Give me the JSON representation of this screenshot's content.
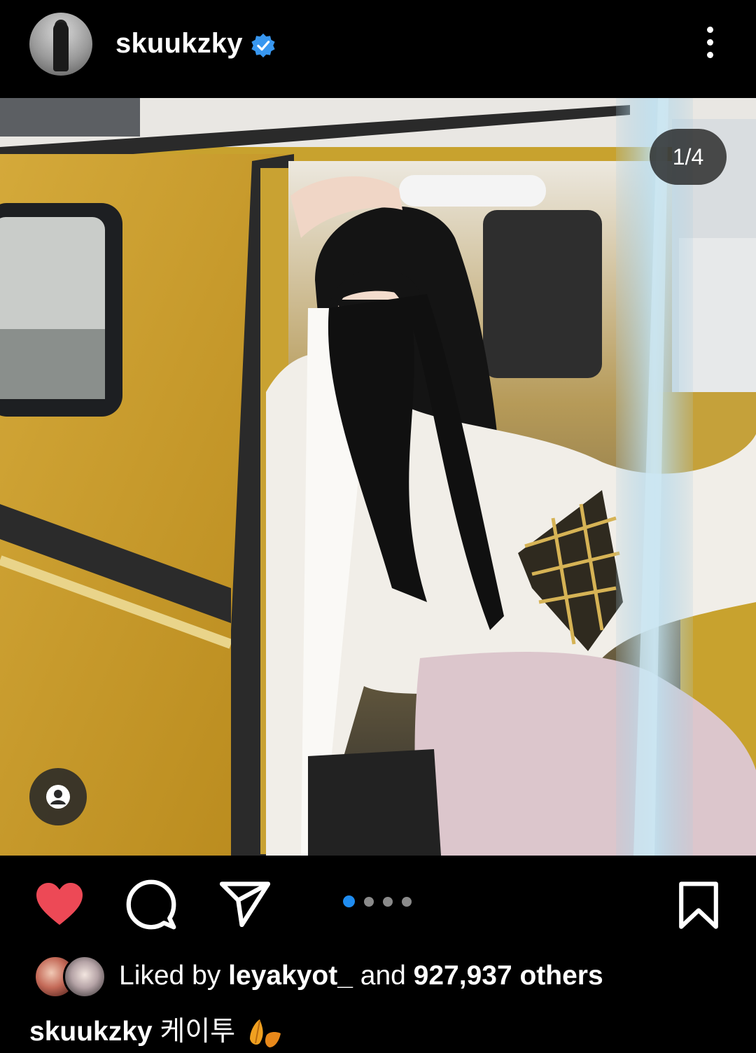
{
  "header": {
    "username": "skuukzky",
    "verified_icon": "verified-badge-icon",
    "more_icon": "more-vertical-icon"
  },
  "post": {
    "image_counter": "1/4",
    "tag_icon": "user-tag-icon",
    "carousel": {
      "total": 4,
      "active_index": 0
    }
  },
  "actions": {
    "like_icon": "heart-filled-icon",
    "comment_icon": "comment-icon",
    "share_icon": "send-icon",
    "save_icon": "bookmark-icon"
  },
  "likes": {
    "prefix": "Liked by",
    "user": "leyakyot_",
    "middle": "and",
    "count_text": "927,937 others"
  },
  "caption": {
    "username": "skuukzky",
    "text": "케이투",
    "emoji_icon": "fallen-leaf-icon"
  },
  "colors": {
    "background": "#000000",
    "like_red": "#ed4956",
    "active_dot": "#1f8cf0",
    "verified_blue": "#3897f0"
  }
}
